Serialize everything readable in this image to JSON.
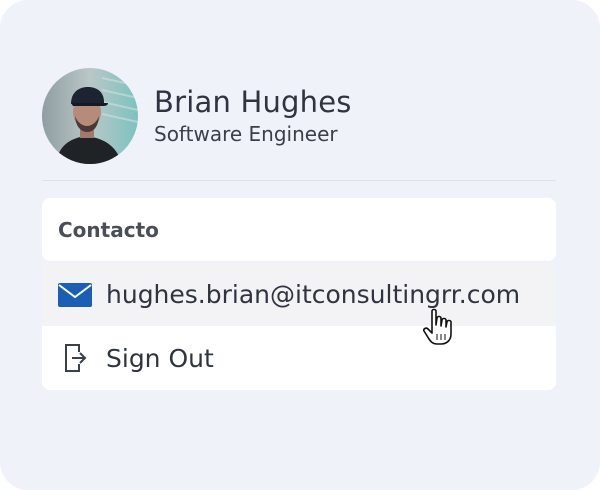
{
  "profile": {
    "name": "Brian Hughes",
    "title": "Software Engineer",
    "avatar_icon": "avatar-photo"
  },
  "menu": {
    "section_label": "Contacto",
    "items": [
      {
        "label": "hughes.brian@itconsultingrr.com",
        "icon": "mail-icon"
      },
      {
        "label": "Sign Out",
        "icon": "sign-out-icon"
      }
    ]
  },
  "colors": {
    "card_background": "#eff2f8",
    "mail_icon": "#1b5fb4",
    "text": "#2f3440"
  },
  "cursor_icon": "hand-pointer"
}
